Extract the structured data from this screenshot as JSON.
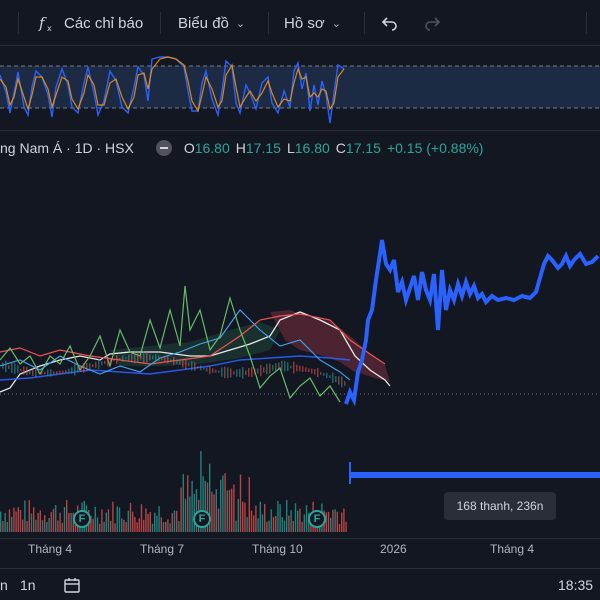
{
  "toolbar": {
    "indicators_label": "Các chỉ báo",
    "chart_type_label": "Biểu đồ",
    "profile_label": "Hồ sơ"
  },
  "legend": {
    "symbol_text": "ng Nam Á · 1D · HSX",
    "open_label": "O",
    "open_value": "16.80",
    "high_label": "H",
    "high_value": "17.15",
    "low_label": "L",
    "low_value": "16.80",
    "close_label": "C",
    "close_value": "17.15",
    "change_text": "+0.15 (+0.88%)"
  },
  "tooltip": {
    "text": "168 thanh, 236n"
  },
  "xaxis": {
    "labels": [
      "Tháng 4",
      "Tháng 7",
      "Tháng 10",
      "2026",
      "Tháng 4"
    ]
  },
  "bottombar": {
    "range_1": "n",
    "range_2": "1n",
    "time": "18:35"
  },
  "events": {
    "badge_label": "F"
  },
  "colors": {
    "up": "#26a69a",
    "down": "#ef5350",
    "accent": "#2962ff",
    "background": "#131722"
  }
}
